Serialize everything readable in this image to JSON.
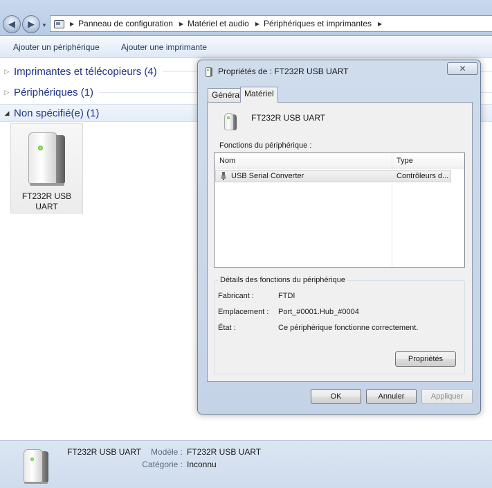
{
  "breadcrumb": {
    "items": [
      "Panneau de configuration",
      "Matériel et audio",
      "Périphériques et imprimantes"
    ]
  },
  "commands": {
    "add_device": "Ajouter un périphérique",
    "add_printer": "Ajouter une imprimante"
  },
  "groups": [
    {
      "label": "Imprimantes et télécopieurs (4)",
      "expanded": false
    },
    {
      "label": "Périphériques (1)",
      "expanded": false
    },
    {
      "label": "Non spécifié(e) (1)",
      "expanded": true
    }
  ],
  "tile": {
    "line1": "FT232R USB",
    "line2": "UART"
  },
  "status": {
    "name": "FT232R USB UART",
    "model_key": "Modèle :",
    "model_val": "FT232R USB UART",
    "category_key": "Catégorie :",
    "category_val": "Inconnu"
  },
  "dialog": {
    "title": "Propriétés de : FT232R USB UART",
    "close_glyph": "✕",
    "tabs": [
      "Général",
      "Matériel"
    ],
    "active_tab": "Matériel",
    "device_name": "FT232R USB UART",
    "functions_label": "Fonctions du périphérique :",
    "columns": [
      "Nom",
      "Type"
    ],
    "rows": [
      {
        "name": "USB Serial Converter",
        "type": "Contrôleurs d..."
      }
    ],
    "details": {
      "legend": "Détails des fonctions du périphérique",
      "manufacturer_key": "Fabricant :",
      "manufacturer_val": "FTDI",
      "location_key": "Emplacement :",
      "location_val": "Port_#0001.Hub_#0004",
      "state_key": "État :",
      "state_val": "Ce périphérique fonctionne correctement."
    },
    "properties_button": "Propriétés",
    "ok_button": "OK",
    "cancel_button": "Annuler",
    "apply_button": "Appliquer"
  },
  "icons": {
    "back": "back-arrow-icon",
    "forward": "forward-arrow-icon",
    "device": "usb-device-icon"
  }
}
